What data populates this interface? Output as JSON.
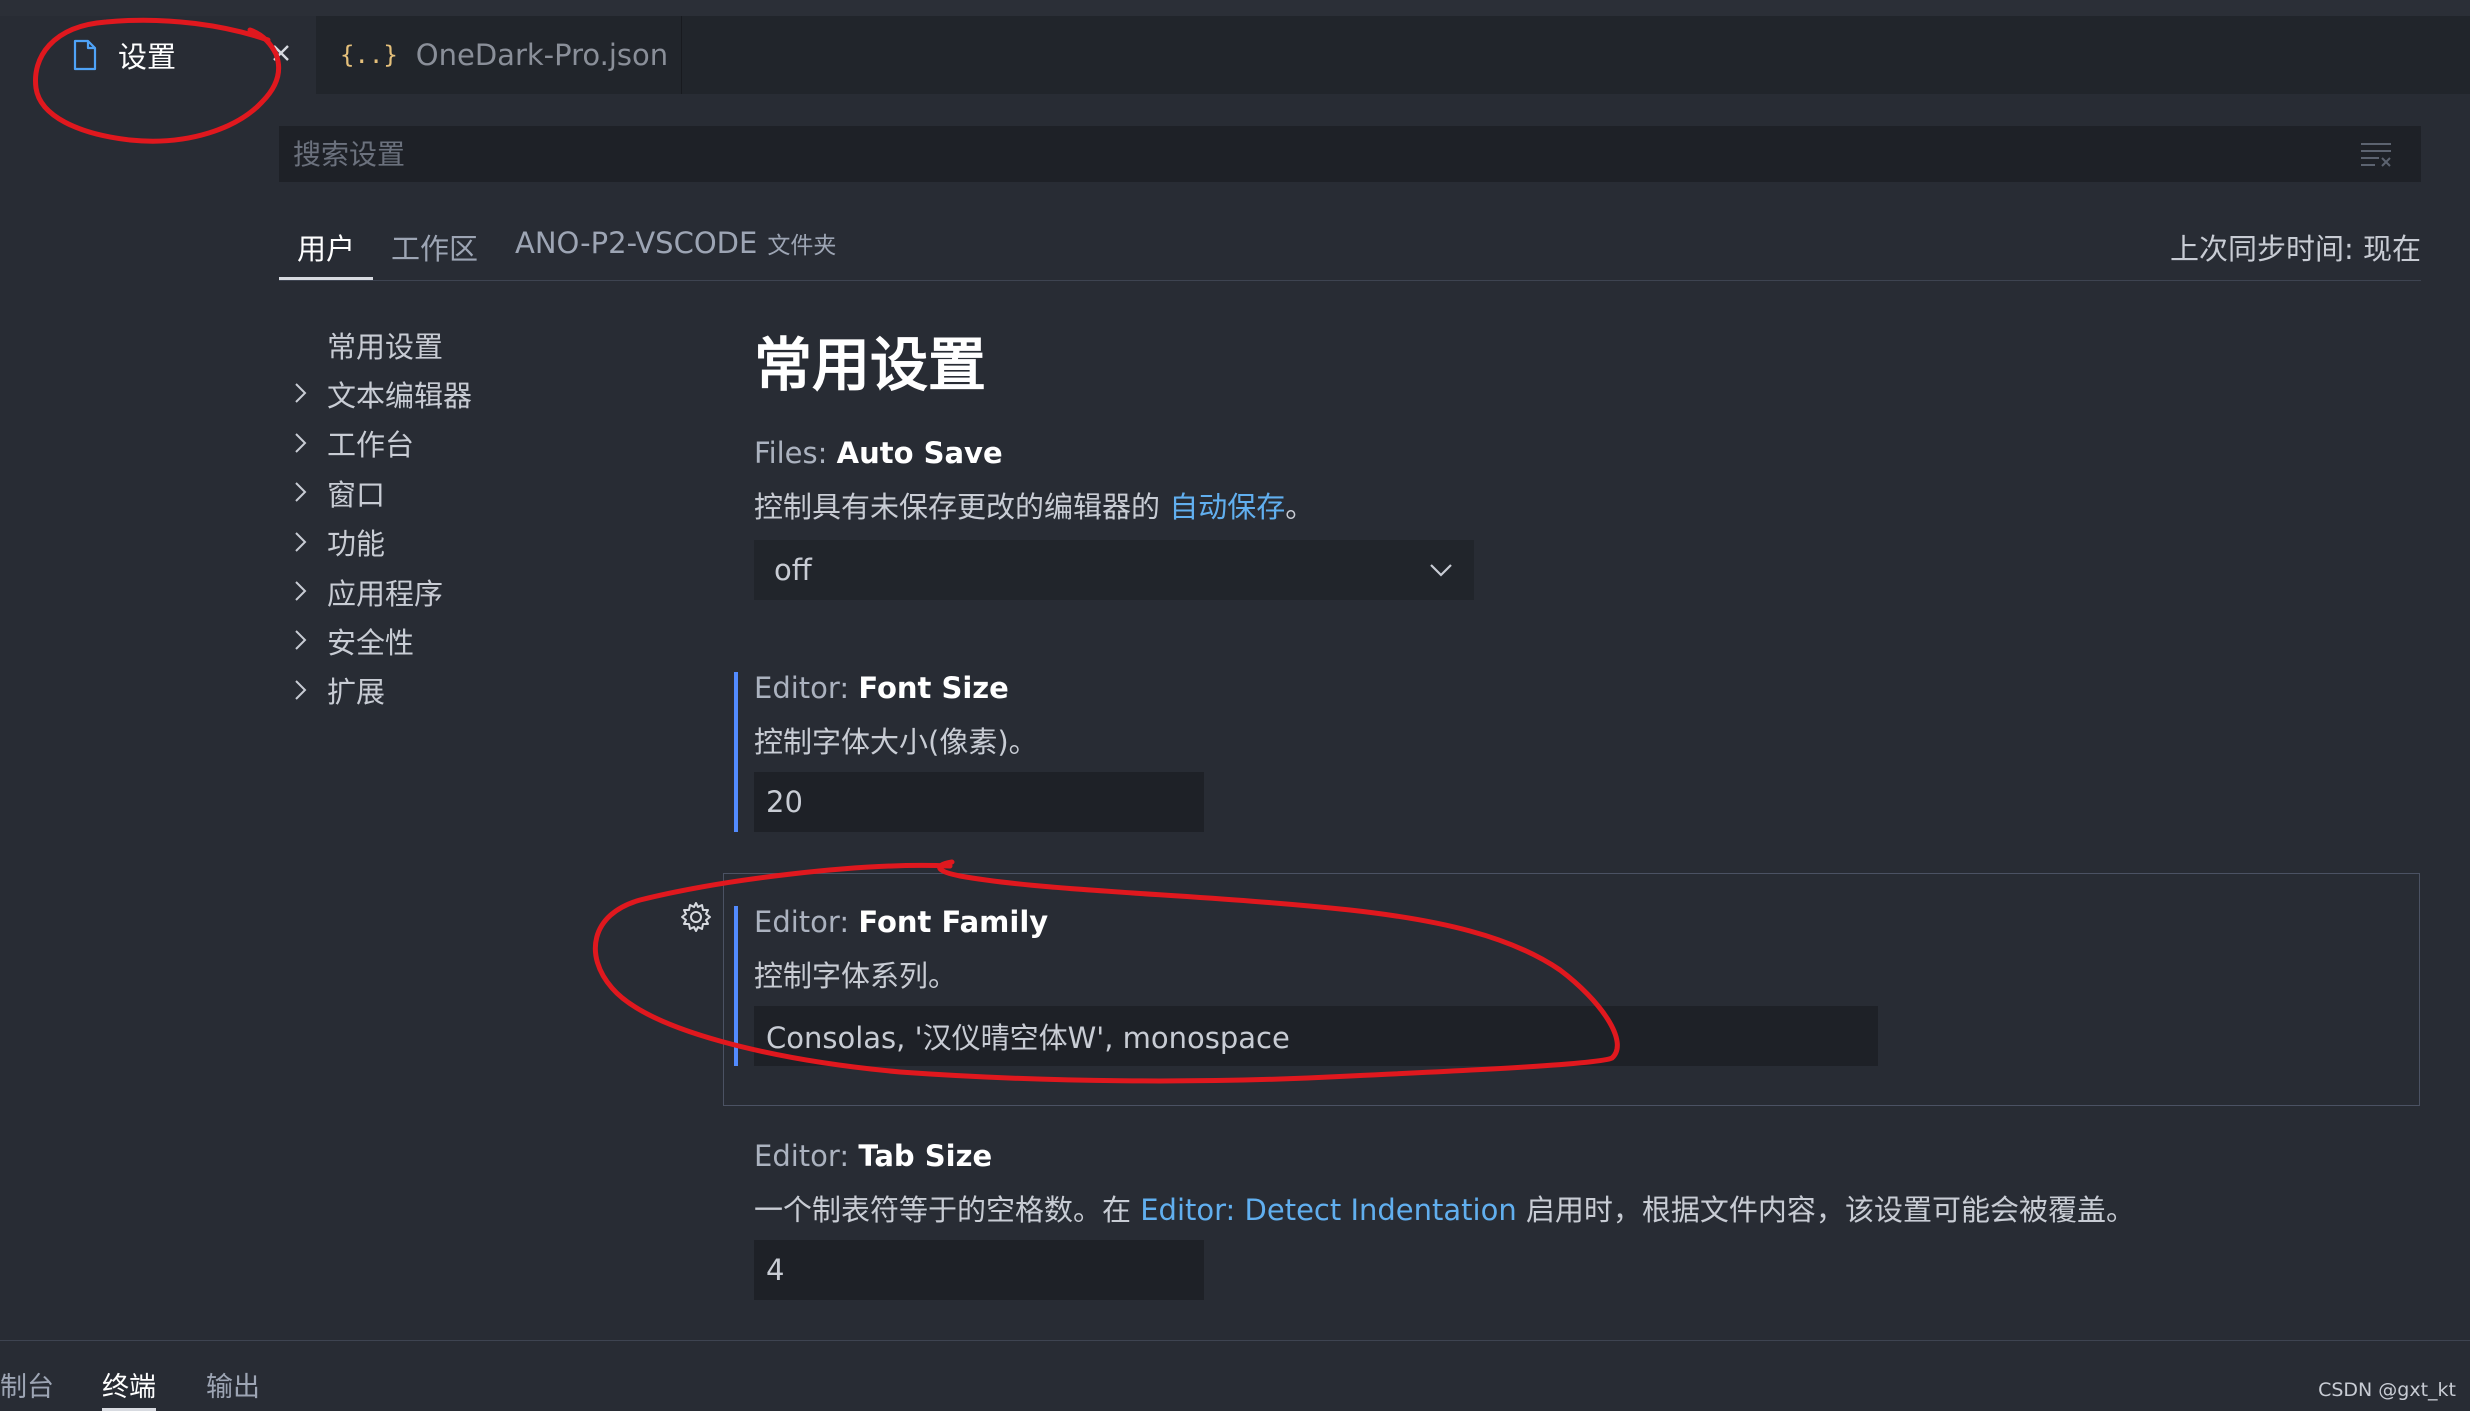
{
  "tabs": {
    "settings": {
      "label": "设置",
      "icon": "file-icon"
    },
    "json": {
      "label": "OneDark-Pro.json",
      "icon": "json-braces-icon"
    }
  },
  "search": {
    "placeholder": "搜索设置",
    "value": ""
  },
  "scope_tabs": {
    "user": "用户",
    "workspace": "工作区",
    "folder": "ANO-P2-VSCODE",
    "folder_suffix": "文件夹",
    "sync_status": "上次同步时间: 现在"
  },
  "toc": {
    "items": [
      {
        "label": "常用设置"
      },
      {
        "label": "文本编辑器"
      },
      {
        "label": "工作台"
      },
      {
        "label": "窗口"
      },
      {
        "label": "功能"
      },
      {
        "label": "应用程序"
      },
      {
        "label": "安全性"
      },
      {
        "label": "扩展"
      }
    ]
  },
  "section_title": "常用设置",
  "settings": {
    "auto_save": {
      "category": "Files: ",
      "name": "Auto Save",
      "desc_before": "控制具有未保存更改的编辑器的 ",
      "desc_link": "自动保存",
      "desc_after": "。",
      "value": "off"
    },
    "font_size": {
      "category": "Editor: ",
      "name": "Font Size",
      "desc": "控制字体大小(像素)。",
      "value": "20"
    },
    "font_family": {
      "category": "Editor: ",
      "name": "Font Family",
      "desc": "控制字体系列。",
      "value": "Consolas, '汉仪晴空体W', monospace"
    },
    "tab_size": {
      "category": "Editor: ",
      "name": "Tab Size",
      "desc_before": "一个制表符等于的空格数。在 ",
      "desc_link": "Editor: Detect Indentation",
      "desc_after": " 启用时，根据文件内容，该设置可能会被覆盖。",
      "value": "4"
    }
  },
  "panel": {
    "console": "制台",
    "terminal": "终端",
    "output": "输出"
  },
  "watermark": "CSDN @gxt_kt",
  "colors": {
    "background": "#282c34",
    "link": "#61afef",
    "modified_indicator": "#528bff",
    "annotation": "#e0181e",
    "json_icon": "#e5c07b"
  }
}
